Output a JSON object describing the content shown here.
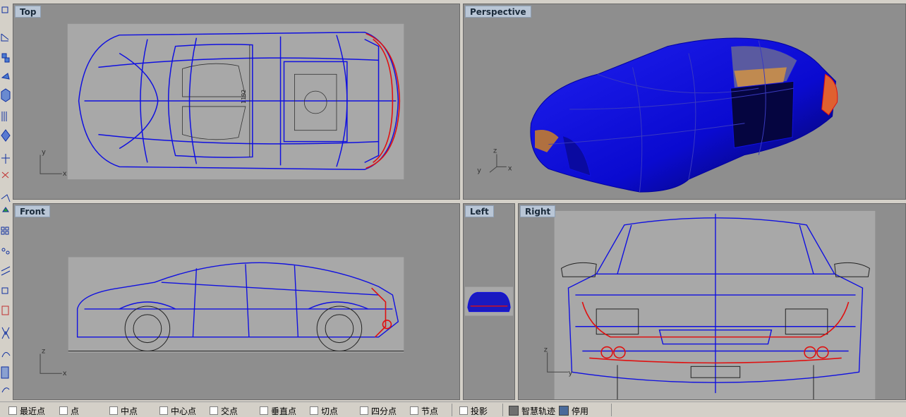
{
  "viewports": {
    "top": {
      "label": "Top",
      "axis_x": "x",
      "axis_y": "y",
      "dimension": "1192"
    },
    "perspective": {
      "label": "Perspective",
      "axis_x": "x",
      "axis_y": "y",
      "axis_z": "z"
    },
    "front": {
      "label": "Front",
      "axis_x": "x",
      "axis_z": "z"
    },
    "left": {
      "label": "Left"
    },
    "right": {
      "label": "Right",
      "axis_y": "y",
      "axis_z": "z"
    }
  },
  "status": {
    "snaps": [
      {
        "label": "最近点"
      },
      {
        "label": "点"
      },
      {
        "label": "中点"
      },
      {
        "label": "中心点"
      },
      {
        "label": "交点"
      },
      {
        "label": "垂直点"
      },
      {
        "label": "切点"
      },
      {
        "label": "四分点"
      },
      {
        "label": "节点"
      },
      {
        "label": "投影"
      }
    ],
    "smart_track": "智慧轨迹",
    "disable": "停用"
  },
  "colors": {
    "viewport_bg": "#8e8e8e",
    "wire": "#1010e0",
    "highlight": "#e01010",
    "label_bg": "#b9c6d6"
  },
  "icons": [
    "toolbar-tool-icons"
  ]
}
